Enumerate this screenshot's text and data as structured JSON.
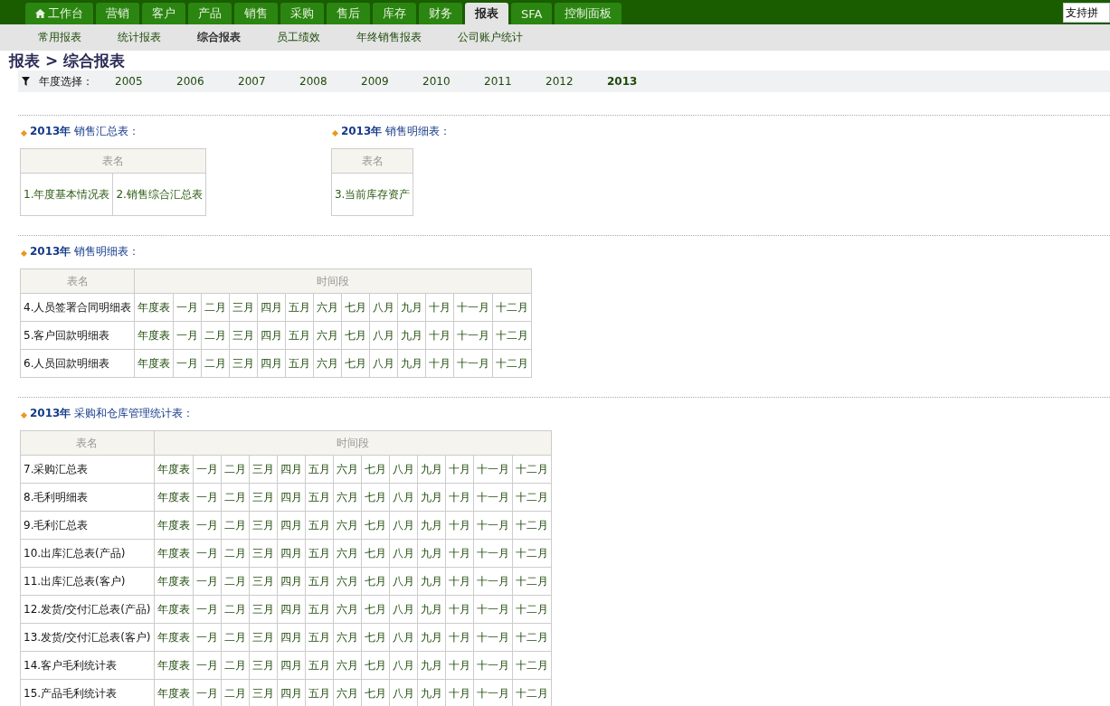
{
  "nav": {
    "tabs": [
      {
        "label": "工作台",
        "selected": false
      },
      {
        "label": "营销",
        "selected": false
      },
      {
        "label": "客户",
        "selected": false
      },
      {
        "label": "产品",
        "selected": false
      },
      {
        "label": "销售",
        "selected": false
      },
      {
        "label": "采购",
        "selected": false
      },
      {
        "label": "售后",
        "selected": false
      },
      {
        "label": "库存",
        "selected": false
      },
      {
        "label": "财务",
        "selected": false
      },
      {
        "label": "报表",
        "selected": true
      },
      {
        "label": "SFA",
        "selected": false
      },
      {
        "label": "控制面板",
        "selected": false
      }
    ],
    "search": {
      "value": "支持拼"
    }
  },
  "subnav": [
    {
      "label": "常用报表",
      "selected": false
    },
    {
      "label": "统计报表",
      "selected": false
    },
    {
      "label": "综合报表",
      "selected": true
    },
    {
      "label": "员工绩效",
      "selected": false
    },
    {
      "label": "年终销售报表",
      "selected": false
    },
    {
      "label": "公司账户统计",
      "selected": false
    }
  ],
  "breadcrumb": "报表 > 综合报表",
  "year_filter": {
    "label": "年度选择：",
    "years": [
      {
        "label": "2005",
        "selected": false
      },
      {
        "label": "2006",
        "selected": false
      },
      {
        "label": "2007",
        "selected": false
      },
      {
        "label": "2008",
        "selected": false
      },
      {
        "label": "2009",
        "selected": false
      },
      {
        "label": "2010",
        "selected": false
      },
      {
        "label": "2011",
        "selected": false
      },
      {
        "label": "2012",
        "selected": false
      },
      {
        "label": "2013",
        "selected": true
      }
    ]
  },
  "sections": [
    {
      "kind": "list",
      "panels": [
        {
          "heading": "**2013年** 销售汇总表：",
          "header": "表名",
          "items": [
            "1.年度基本情况表",
            "2.销售综合汇总表"
          ]
        },
        {
          "heading": "**2013年** 销售明细表：",
          "header": "表名",
          "items": [
            "3.当前库存资产"
          ]
        }
      ]
    },
    {
      "kind": "grid",
      "heading": "**2013年** 销售明细表：",
      "columns": [
        "表名",
        "时间段"
      ],
      "rows": [
        {
          "name": "4.人员签署合同明细表",
          "periods": [
            "年度表",
            "一月",
            "二月",
            "三月",
            "四月",
            "五月",
            "六月",
            "七月",
            "八月",
            "九月",
            "十月",
            "十一月",
            "十二月"
          ]
        },
        {
          "name": "5.客户回款明细表",
          "periods": [
            "年度表",
            "一月",
            "二月",
            "三月",
            "四月",
            "五月",
            "六月",
            "七月",
            "八月",
            "九月",
            "十月",
            "十一月",
            "十二月"
          ]
        },
        {
          "name": "6.人员回款明细表",
          "periods": [
            "年度表",
            "一月",
            "二月",
            "三月",
            "四月",
            "五月",
            "六月",
            "七月",
            "八月",
            "九月",
            "十月",
            "十一月",
            "十二月"
          ]
        }
      ]
    },
    {
      "kind": "grid",
      "heading": "**2013年** 采购和仓库管理统计表：",
      "columns": [
        "表名",
        "时间段"
      ],
      "rows": [
        {
          "name": "7.采购汇总表",
          "periods": [
            "年度表",
            "一月",
            "二月",
            "三月",
            "四月",
            "五月",
            "六月",
            "七月",
            "八月",
            "九月",
            "十月",
            "十一月",
            "十二月"
          ]
        },
        {
          "name": "8.毛利明细表",
          "periods": [
            "年度表",
            "一月",
            "二月",
            "三月",
            "四月",
            "五月",
            "六月",
            "七月",
            "八月",
            "九月",
            "十月",
            "十一月",
            "十二月"
          ]
        },
        {
          "name": "9.毛利汇总表",
          "periods": [
            "年度表",
            "一月",
            "二月",
            "三月",
            "四月",
            "五月",
            "六月",
            "七月",
            "八月",
            "九月",
            "十月",
            "十一月",
            "十二月"
          ]
        },
        {
          "name": "10.出库汇总表(产品)",
          "periods": [
            "年度表",
            "一月",
            "二月",
            "三月",
            "四月",
            "五月",
            "六月",
            "七月",
            "八月",
            "九月",
            "十月",
            "十一月",
            "十二月"
          ]
        },
        {
          "name": "11.出库汇总表(客户)",
          "periods": [
            "年度表",
            "一月",
            "二月",
            "三月",
            "四月",
            "五月",
            "六月",
            "七月",
            "八月",
            "九月",
            "十月",
            "十一月",
            "十二月"
          ]
        },
        {
          "name": "12.发货/交付汇总表(产品)",
          "periods": [
            "年度表",
            "一月",
            "二月",
            "三月",
            "四月",
            "五月",
            "六月",
            "七月",
            "八月",
            "九月",
            "十月",
            "十一月",
            "十二月"
          ]
        },
        {
          "name": "13.发货/交付汇总表(客户)",
          "periods": [
            "年度表",
            "一月",
            "二月",
            "三月",
            "四月",
            "五月",
            "六月",
            "七月",
            "八月",
            "九月",
            "十月",
            "十一月",
            "十二月"
          ]
        },
        {
          "name": "14.客户毛利统计表",
          "periods": [
            "年度表",
            "一月",
            "二月",
            "三月",
            "四月",
            "五月",
            "六月",
            "七月",
            "八月",
            "九月",
            "十月",
            "十一月",
            "十二月"
          ]
        },
        {
          "name": "15.产品毛利统计表",
          "periods": [
            "年度表",
            "一月",
            "二月",
            "三月",
            "四月",
            "五月",
            "六月",
            "七月",
            "八月",
            "九月",
            "十月",
            "十一月",
            "十二月"
          ]
        }
      ]
    }
  ]
}
